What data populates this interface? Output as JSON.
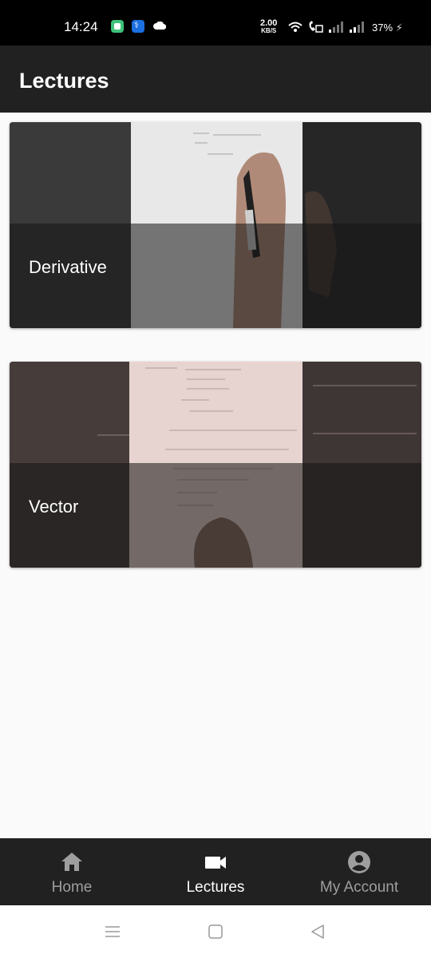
{
  "status_bar": {
    "time": "14:24",
    "net_speed_value": "2.00",
    "net_speed_unit": "KB/S",
    "battery": "37%"
  },
  "app_bar": {
    "title": "Lectures"
  },
  "lectures": [
    {
      "title": "Derivative"
    },
    {
      "title": "Vector"
    }
  ],
  "bottom_nav": {
    "items": [
      {
        "label": "Home",
        "icon": "home-icon",
        "active": false
      },
      {
        "label": "Lectures",
        "icon": "video-camera-icon",
        "active": true
      },
      {
        "label": "My Account",
        "icon": "account-circle-icon",
        "active": false
      }
    ]
  },
  "colors": {
    "app_bar": "#212121",
    "background": "#fafafa",
    "inactive_label": "#9e9e9e",
    "active_label": "#ffffff"
  }
}
